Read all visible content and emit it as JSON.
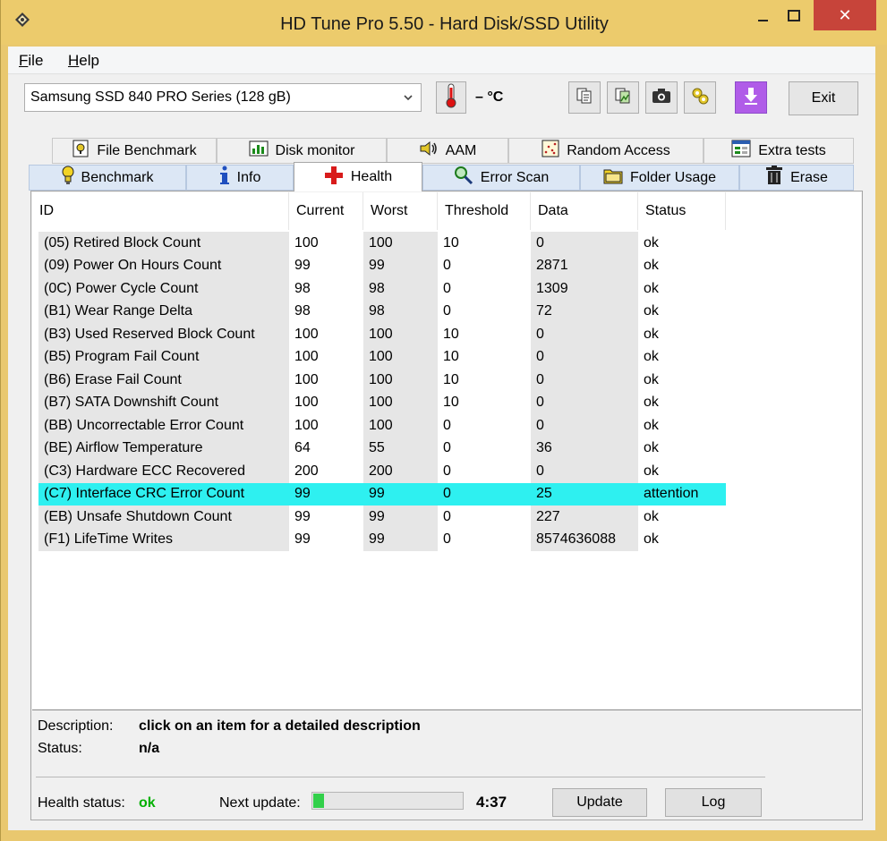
{
  "window": {
    "title": "HD Tune Pro 5.50 - Hard Disk/SSD Utility",
    "close_glyph": "✕"
  },
  "menu": {
    "items": [
      {
        "accel": "F",
        "rest": "ile"
      },
      {
        "accel": "H",
        "rest": "elp"
      }
    ]
  },
  "toolbar": {
    "drive": "Samsung SSD 840 PRO Series (128 gB)",
    "temperature": "– °C",
    "exit_label": "Exit"
  },
  "tabs_row1": [
    {
      "label": "File Benchmark"
    },
    {
      "label": "Disk monitor"
    },
    {
      "label": "AAM"
    },
    {
      "label": "Random Access"
    },
    {
      "label": "Extra tests"
    }
  ],
  "tabs_row2": [
    {
      "label": "Benchmark"
    },
    {
      "label": "Info"
    },
    {
      "label": "Health"
    },
    {
      "label": "Error Scan"
    },
    {
      "label": "Folder Usage"
    },
    {
      "label": "Erase"
    }
  ],
  "active_tab": "Health",
  "table": {
    "columns": [
      "ID",
      "Current",
      "Worst",
      "Threshold",
      "Data",
      "Status"
    ],
    "rows": [
      [
        "(05) Retired Block Count",
        "100",
        "100",
        "10",
        "0",
        "ok"
      ],
      [
        "(09) Power On Hours Count",
        "99",
        "99",
        "0",
        "2871",
        "ok"
      ],
      [
        "(0C) Power Cycle Count",
        "98",
        "98",
        "0",
        "1309",
        "ok"
      ],
      [
        "(B1) Wear Range Delta",
        "98",
        "98",
        "0",
        "72",
        "ok"
      ],
      [
        "(B3) Used Reserved Block Count",
        "100",
        "100",
        "10",
        "0",
        "ok"
      ],
      [
        "(B5) Program Fail Count",
        "100",
        "100",
        "10",
        "0",
        "ok"
      ],
      [
        "(B6) Erase Fail Count",
        "100",
        "100",
        "10",
        "0",
        "ok"
      ],
      [
        "(B7) SATA Downshift Count",
        "100",
        "100",
        "10",
        "0",
        "ok"
      ],
      [
        "(BB) Uncorrectable Error Count",
        "100",
        "100",
        "0",
        "0",
        "ok"
      ],
      [
        "(BE) Airflow Temperature",
        "64",
        "55",
        "0",
        "36",
        "ok"
      ],
      [
        "(C3) Hardware ECC Recovered",
        "200",
        "200",
        "0",
        "0",
        "ok"
      ],
      [
        "(C7) Interface CRC Error Count",
        "99",
        "99",
        "0",
        "25",
        "attention"
      ],
      [
        "(EB) Unsafe Shutdown Count",
        "99",
        "99",
        "0",
        "227",
        "ok"
      ],
      [
        "(F1) LifeTime Writes",
        "99",
        "99",
        "0",
        "8574636088",
        "ok"
      ]
    ],
    "selected_row": 11,
    "highlight_color": "#2ef0f0"
  },
  "details": {
    "description_label": "Description:",
    "description_value": "click on an item for a detailed description",
    "status_label": "Status:",
    "status_value": "n/a"
  },
  "footer": {
    "health_label": "Health status:",
    "health_value": "ok",
    "next_update_label": "Next update:",
    "progress_fraction": 0.07,
    "timer": "4:37",
    "update_label": "Update",
    "log_label": "Log"
  }
}
